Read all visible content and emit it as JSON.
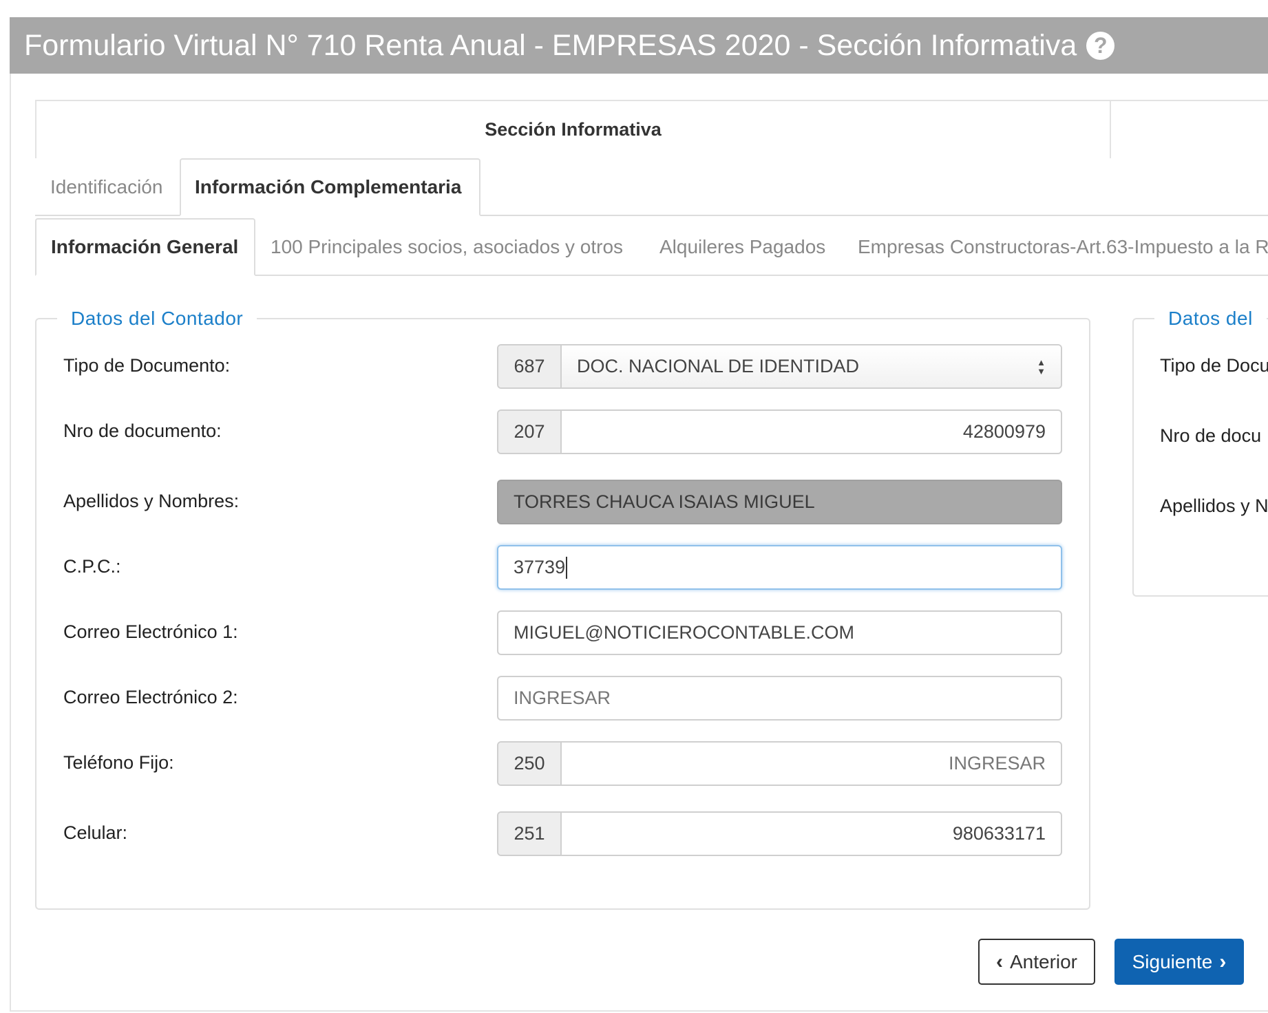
{
  "window": {
    "title": "Formulario Virtual N° 710 Renta Anual - EMPRESAS 2020 - Sección Informativa",
    "help_icon": "question-circle-icon"
  },
  "section": {
    "title": "Sección Informativa"
  },
  "tabs_level1": [
    {
      "label": "Identificación",
      "active": false
    },
    {
      "label": "Información Complementaria",
      "active": true
    }
  ],
  "tabs_level2": [
    {
      "label": "Información General",
      "active": true
    },
    {
      "label": "100 Principales socios, asociados y otros",
      "active": false
    },
    {
      "label": "Alquileres Pagados",
      "active": false
    },
    {
      "label": "Empresas Constructoras-Art.63-Impuesto a la R",
      "active": false
    }
  ],
  "contador": {
    "legend": "Datos del Contador",
    "tipo_documento": {
      "label": "Tipo de Documento:",
      "code": "687",
      "value": "DOC. NACIONAL DE IDENTIDAD"
    },
    "nro_documento": {
      "label": "Nro de documento:",
      "code": "207",
      "value": "42800979"
    },
    "apellidos_nombres": {
      "label": "Apellidos y Nombres:",
      "value": "TORRES CHAUCA ISAIAS MIGUEL"
    },
    "cpc": {
      "label": "C.P.C.:",
      "value": "37739"
    },
    "correo1": {
      "label": "Correo Electrónico 1:",
      "value": "MIGUEL@NOTICIEROCONTABLE.COM"
    },
    "correo2": {
      "label": "Correo Electrónico 2:",
      "placeholder": "INGRESAR"
    },
    "telefono_fijo": {
      "label": "Teléfono Fijo:",
      "code": "250",
      "placeholder": "INGRESAR"
    },
    "celular": {
      "label": "Celular:",
      "code": "251",
      "value": "980633171"
    }
  },
  "right_panel": {
    "legend": "Datos del",
    "labels": [
      "Tipo de Docu",
      "Nro de docu",
      "Apellidos y N"
    ]
  },
  "buttons": {
    "prev": "Anterior",
    "next": "Siguiente"
  },
  "colors": {
    "titlebar": "#a7a7a7",
    "legend": "#1b7fc9",
    "primary": "#0f63b1"
  }
}
